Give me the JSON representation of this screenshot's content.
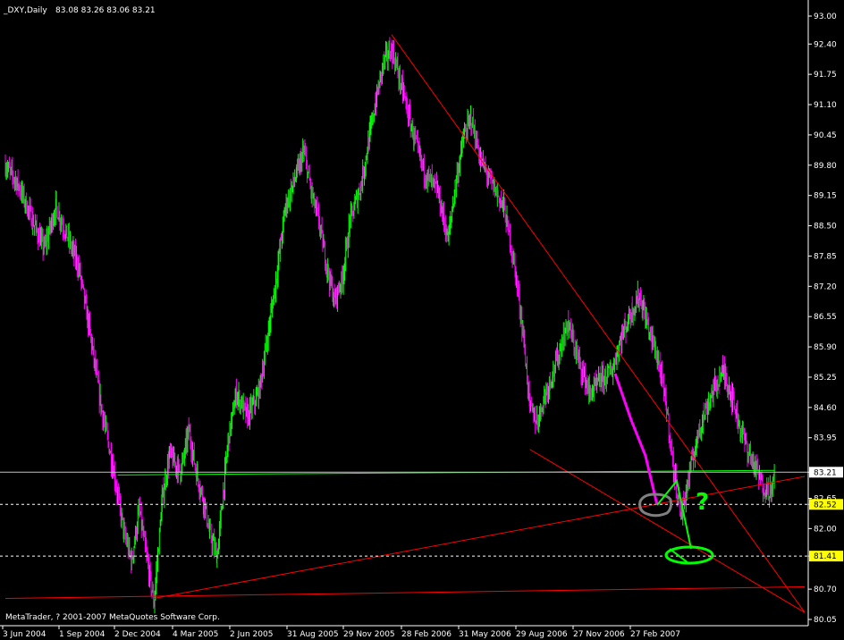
{
  "header": {
    "symbol": "_DXY,Daily",
    "ohlc": "83.08 83.26 83.06 83.21"
  },
  "footer": {
    "copyright": "MetaTrader, ? 2001-2007 MetaQuotes Software Corp."
  },
  "annotation": {
    "question_mark": "?"
  },
  "colors": {
    "background": "#000000",
    "bull_candle": "#00ff00",
    "bear_candle": "#ff00ff",
    "neutral_candle": "#808080",
    "trendline": "#ff0000",
    "support_line": "#00ff00",
    "current_price_line": "#c0c0c0",
    "level_line": "#ffffff",
    "price_tag_fill": "#ffff00",
    "drawing_green": "#00ff00",
    "drawing_gray": "#808080",
    "drawing_magenta": "#ff00ff"
  },
  "chart_data": {
    "type": "candlestick",
    "title": "_DXY,Daily",
    "ylim": [
      80.05,
      93.0
    ],
    "y_ticks": [
      "93.00",
      "92.40",
      "91.75",
      "91.10",
      "90.45",
      "89.80",
      "89.15",
      "88.50",
      "87.85",
      "87.20",
      "86.55",
      "85.90",
      "85.25",
      "84.60",
      "83.95",
      "83.21",
      "82.65",
      "82.52",
      "82.00",
      "81.41",
      "80.70",
      "80.05"
    ],
    "x_ticks": [
      "3 Jun 2004",
      "1 Sep 2004",
      "2 Dec 2004",
      "4 Mar 2005",
      "2 Jun 2005",
      "31 Aug 2005",
      "29 Nov 2005",
      "28 Feb 2006",
      "31 May 2006",
      "29 Aug 2006",
      "27 Nov 2006",
      "27 Feb 2007"
    ],
    "price_path": [
      [
        "2004-06-03",
        89.8
      ],
      [
        "2004-06-20",
        89.4
      ],
      [
        "2004-07-10",
        88.6
      ],
      [
        "2004-07-25",
        88.0
      ],
      [
        "2004-08-10",
        88.9
      ],
      [
        "2004-08-25",
        88.3
      ],
      [
        "2004-09-10",
        87.6
      ],
      [
        "2004-09-25",
        86.2
      ],
      [
        "2004-10-10",
        84.6
      ],
      [
        "2004-10-25",
        83.4
      ],
      [
        "2004-11-10",
        81.9
      ],
      [
        "2004-11-20",
        81.3
      ],
      [
        "2004-11-30",
        82.4
      ],
      [
        "2004-12-10",
        81.4
      ],
      [
        "2004-12-20",
        80.4
      ],
      [
        "2004-12-31",
        82.6
      ],
      [
        "2005-01-10",
        83.6
      ],
      [
        "2005-01-25",
        83.2
      ],
      [
        "2005-02-05",
        84.1
      ],
      [
        "2005-02-15",
        83.2
      ],
      [
        "2005-02-25",
        82.6
      ],
      [
        "2005-03-05",
        81.9
      ],
      [
        "2005-03-15",
        81.4
      ],
      [
        "2005-03-30",
        83.9
      ],
      [
        "2005-04-10",
        84.9
      ],
      [
        "2005-04-25",
        84.4
      ],
      [
        "2005-05-10",
        84.9
      ],
      [
        "2005-05-20",
        85.9
      ],
      [
        "2005-06-01",
        87.2
      ],
      [
        "2005-06-15",
        88.9
      ],
      [
        "2005-06-30",
        89.6
      ],
      [
        "2005-07-10",
        90.1
      ],
      [
        "2005-07-20",
        89.2
      ],
      [
        "2005-07-30",
        88.6
      ],
      [
        "2005-08-10",
        87.6
      ],
      [
        "2005-08-20",
        86.9
      ],
      [
        "2005-08-31",
        87.4
      ],
      [
        "2005-09-10",
        88.6
      ],
      [
        "2005-09-25",
        89.4
      ],
      [
        "2005-10-05",
        90.3
      ],
      [
        "2005-10-15",
        91.2
      ],
      [
        "2005-10-25",
        92.0
      ],
      [
        "2005-11-05",
        92.3
      ],
      [
        "2005-11-20",
        91.4
      ],
      [
        "2005-12-05",
        90.4
      ],
      [
        "2005-12-20",
        89.6
      ],
      [
        "2006-01-05",
        89.3
      ],
      [
        "2006-01-20",
        88.2
      ],
      [
        "2006-01-30",
        89.4
      ],
      [
        "2006-02-10",
        90.4
      ],
      [
        "2006-02-20",
        90.8
      ],
      [
        "2006-03-05",
        89.9
      ],
      [
        "2006-03-20",
        89.4
      ],
      [
        "2006-04-05",
        88.9
      ],
      [
        "2006-04-20",
        87.6
      ],
      [
        "2006-05-01",
        86.2
      ],
      [
        "2006-05-10",
        84.6
      ],
      [
        "2006-05-20",
        84.3
      ],
      [
        "2006-05-31",
        84.9
      ],
      [
        "2006-06-15",
        85.6
      ],
      [
        "2006-06-30",
        86.4
      ],
      [
        "2006-07-15",
        85.6
      ],
      [
        "2006-07-30",
        84.9
      ],
      [
        "2006-08-15",
        85.2
      ],
      [
        "2006-08-29",
        85.4
      ],
      [
        "2006-09-10",
        86.1
      ],
      [
        "2006-09-25",
        86.7
      ],
      [
        "2006-10-05",
        87.0
      ],
      [
        "2006-10-15",
        86.4
      ],
      [
        "2006-10-30",
        85.6
      ],
      [
        "2006-11-10",
        84.6
      ],
      [
        "2006-11-20",
        83.2
      ],
      [
        "2006-11-30",
        82.3
      ],
      [
        "2006-12-10",
        83.1
      ],
      [
        "2006-12-25",
        84.2
      ],
      [
        "2007-01-10",
        84.9
      ],
      [
        "2007-01-25",
        85.4
      ],
      [
        "2007-02-05",
        84.9
      ],
      [
        "2007-02-15",
        84.3
      ],
      [
        "2007-02-27",
        83.7
      ],
      [
        "2007-03-10",
        83.3
      ],
      [
        "2007-03-20",
        82.9
      ],
      [
        "2007-04-01",
        82.8
      ],
      [
        "2007-04-05",
        83.21
      ]
    ],
    "current_price": 83.21,
    "horizontal_levels": [
      83.21,
      82.52,
      81.41
    ],
    "highlighted_price_tags": [
      "83.21",
      "82.52",
      "81.41"
    ],
    "trendlines": [
      {
        "from": [
          "2005-11-05",
          92.6
        ],
        "to": [
          "2007-05-15",
          80.2
        ]
      },
      {
        "from": [
          "2004-12-20",
          80.5
        ],
        "to": [
          "2007-05-15",
          83.12
        ]
      },
      {
        "from": [
          "2006-05-10",
          83.7
        ],
        "to": [
          "2007-05-15",
          80.2
        ]
      },
      {
        "from": [
          "2004-06-03",
          80.5
        ],
        "to": [
          "2007-05-15",
          80.75
        ]
      }
    ],
    "support_line": {
      "from": [
        "2004-11-01",
        83.15
      ],
      "to": [
        "2007-04-05",
        83.25
      ]
    },
    "grid": false,
    "legend": "none"
  }
}
